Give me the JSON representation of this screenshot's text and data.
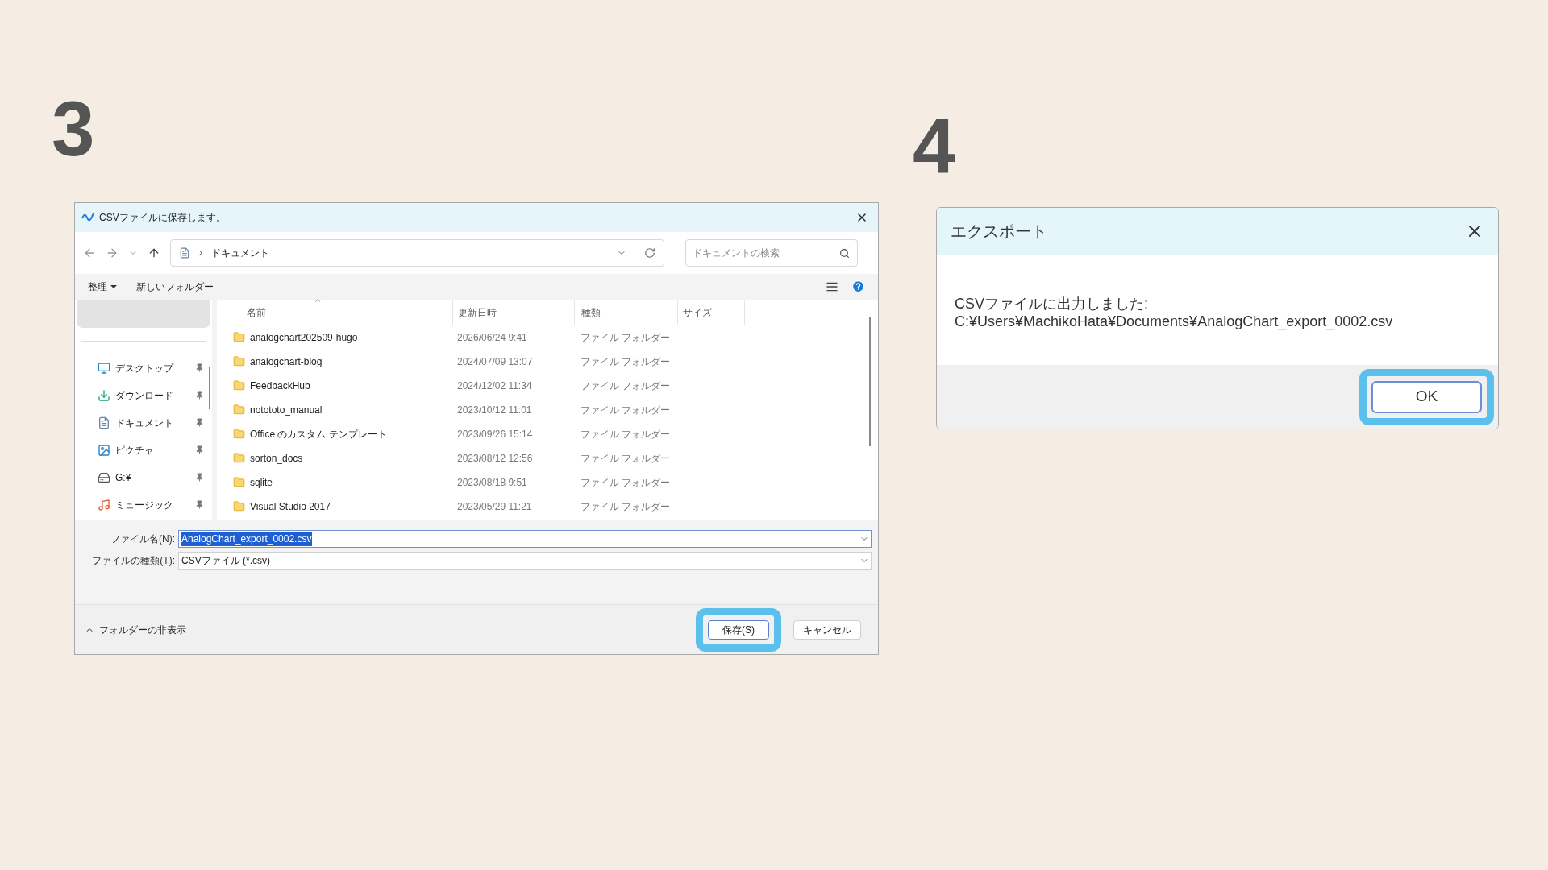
{
  "left_step": {
    "number": "3"
  },
  "save_dialog": {
    "title": "CSVファイルに保存します。",
    "location": "ドキュメント",
    "search": {
      "placeholder": "ドキュメントの検索"
    },
    "toolbar": {
      "organize": "整理",
      "new_folder": "新しいフォルダー"
    },
    "nav_items": [
      {
        "label": "デスクトップ",
        "kind": "desktop"
      },
      {
        "label": "ダウンロード",
        "kind": "download"
      },
      {
        "label": "ドキュメント",
        "kind": "document"
      },
      {
        "label": "ピクチャ",
        "kind": "picture"
      },
      {
        "label": "G:¥",
        "kind": "drive"
      },
      {
        "label": "ミュージック",
        "kind": "music"
      }
    ],
    "columns": [
      "名前",
      "更新日時",
      "種類",
      "サイズ"
    ],
    "rows": [
      {
        "name": "analogchart202509-hugo",
        "modified": "2026/06/24 9:41",
        "type": "ファイル フォルダー"
      },
      {
        "name": "analogchart-blog",
        "modified": "2024/07/09 13:07",
        "type": "ファイル フォルダー"
      },
      {
        "name": "FeedbackHub",
        "modified": "2024/12/02 11:34",
        "type": "ファイル フォルダー"
      },
      {
        "name": "notototo_manual",
        "modified": "2023/10/12 11:01",
        "type": "ファイル フォルダー"
      },
      {
        "name": "Office のカスタム テンプレート",
        "modified": "2023/09/26 15:14",
        "type": "ファイル フォルダー"
      },
      {
        "name": "sorton_docs",
        "modified": "2023/08/12 12:56",
        "type": "ファイル フォルダー"
      },
      {
        "name": "sqlite",
        "modified": "2023/08/18 9:51",
        "type": "ファイル フォルダー"
      },
      {
        "name": "Visual Studio 2017",
        "modified": "2023/05/29 11:21",
        "type": "ファイル フォルダー"
      }
    ],
    "filename": {
      "label": "ファイル名(N):",
      "value": "AnalogChart_export_0002.csv",
      "selected": true
    },
    "filetype": {
      "label": "ファイルの種類(T):",
      "value": "CSVファイル (*.csv)"
    },
    "hide_folders": "フォルダーの非表示",
    "buttons": [
      {
        "label": "保存(S)",
        "highlighted": true
      },
      {
        "label": "キャンセル",
        "highlighted": false
      }
    ]
  },
  "right_step": {
    "number": "4"
  },
  "message_dialog": {
    "title": "エクスポート",
    "lines": [
      "CSVファイルに出力しました:",
      "C:¥Users¥MachikoHata¥Documents¥AnalogChart_export_0002.csv"
    ],
    "buttons": [
      {
        "label": "OK",
        "highlighted": true
      }
    ]
  }
}
